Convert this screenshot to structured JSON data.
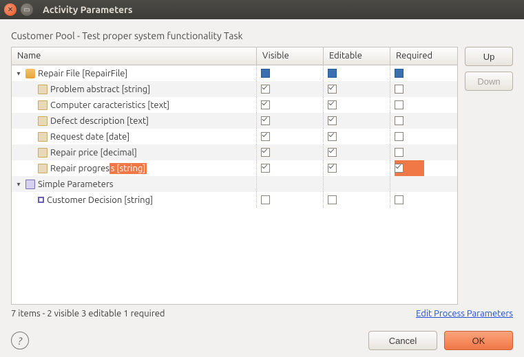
{
  "window": {
    "title": "Activity Parameters"
  },
  "subtitle": "Customer Pool  - Test proper system functionality Task",
  "columns": {
    "name": "Name",
    "visible": "Visible",
    "editable": "Editable",
    "required": "Required"
  },
  "rows": [
    {
      "id": "repair-file",
      "kind": "file",
      "indent": 0,
      "expander": "▾",
      "label": "Repair File [RepairFile]",
      "vis": "filled",
      "edit": "filled",
      "req": "filled",
      "alt": false,
      "sel": false
    },
    {
      "id": "problem-abstract",
      "kind": "field",
      "indent": 1,
      "expander": "",
      "label": "Problem abstract [string]",
      "vis": "checked",
      "edit": "checked",
      "req": "empty",
      "alt": true,
      "sel": false
    },
    {
      "id": "computer-caracteristics",
      "kind": "field",
      "indent": 1,
      "expander": "",
      "label": "Computer caracteristics [text]",
      "vis": "checked",
      "edit": "checked",
      "req": "empty",
      "alt": false,
      "sel": false
    },
    {
      "id": "defect-description",
      "kind": "field",
      "indent": 1,
      "expander": "",
      "label": "Defect description [text]",
      "vis": "checked",
      "edit": "checked",
      "req": "empty",
      "alt": true,
      "sel": false
    },
    {
      "id": "request-date",
      "kind": "field",
      "indent": 1,
      "expander": "",
      "label": "Request date [date]",
      "vis": "checked",
      "edit": "checked",
      "req": "empty",
      "alt": false,
      "sel": false
    },
    {
      "id": "repair-price",
      "kind": "field",
      "indent": 1,
      "expander": "",
      "label": "Repair price [decimal]",
      "vis": "checked",
      "edit": "checked",
      "req": "empty",
      "alt": true,
      "sel": false
    },
    {
      "id": "repair-progress",
      "kind": "field",
      "indent": 1,
      "expander": "",
      "label": "Repair progress [string]",
      "label_prefix": "Repair progres",
      "label_highlight": "s [string]",
      "vis": "checked",
      "edit": "checked",
      "req": "checked",
      "alt": false,
      "sel": true
    },
    {
      "id": "simple-parameters",
      "kind": "group",
      "indent": 0,
      "expander": "▾",
      "label": "Simple Parameters",
      "vis": "",
      "edit": "",
      "req": "",
      "alt": true,
      "sel": false
    },
    {
      "id": "customer-decision",
      "kind": "param",
      "indent": 1,
      "expander": "",
      "label": "Customer Decision [string]",
      "vis": "empty",
      "edit": "empty",
      "req": "empty",
      "alt": false,
      "sel": false
    }
  ],
  "side": {
    "up": "Up",
    "down": "Down"
  },
  "status": "7 items - 2 visible  3 editable  1 required",
  "link": "Edit Process Parameters",
  "actions": {
    "help": "?",
    "cancel": "Cancel",
    "ok": "OK"
  }
}
